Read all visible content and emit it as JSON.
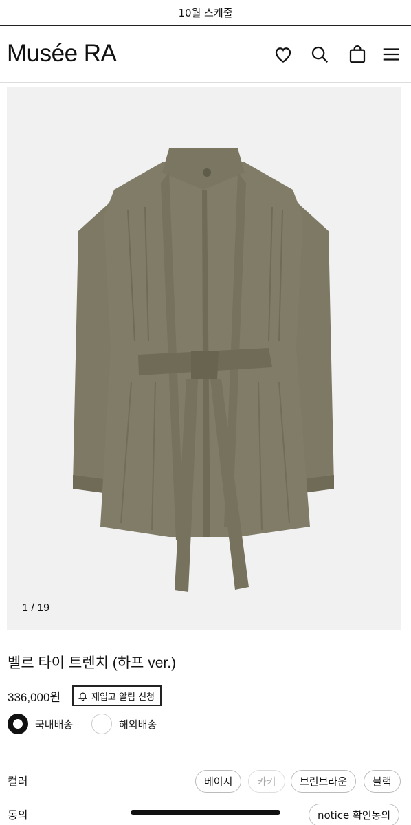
{
  "announcement": "10월 스케줄",
  "brand": "Musée RA",
  "header_icons": [
    "heart-icon",
    "search-icon",
    "shopping-bag-icon",
    "menu-icon"
  ],
  "gallery": {
    "counter": "1 / 19",
    "current": 1,
    "total": 19
  },
  "product": {
    "name": "벨르 타이 트렌치 (하프 ver.)",
    "price": "336,000원",
    "restock_label": "재입고 알림 신청"
  },
  "shipping": [
    {
      "label": "국내배송",
      "selected": true
    },
    {
      "label": "해외배송",
      "selected": false
    }
  ],
  "options": {
    "color_label": "컬러",
    "colors": [
      {
        "label": "베이지",
        "available": true
      },
      {
        "label": "카키",
        "available": false
      },
      {
        "label": "브린브라운",
        "available": true
      },
      {
        "label": "블랙",
        "available": true
      }
    ],
    "consent_label": "동의",
    "consent_value": "notice 확인동의"
  },
  "colors": {
    "coat": "#807c67",
    "coat_shadow": "#6f6b57",
    "gallery_bg": "#f1f1f1"
  }
}
